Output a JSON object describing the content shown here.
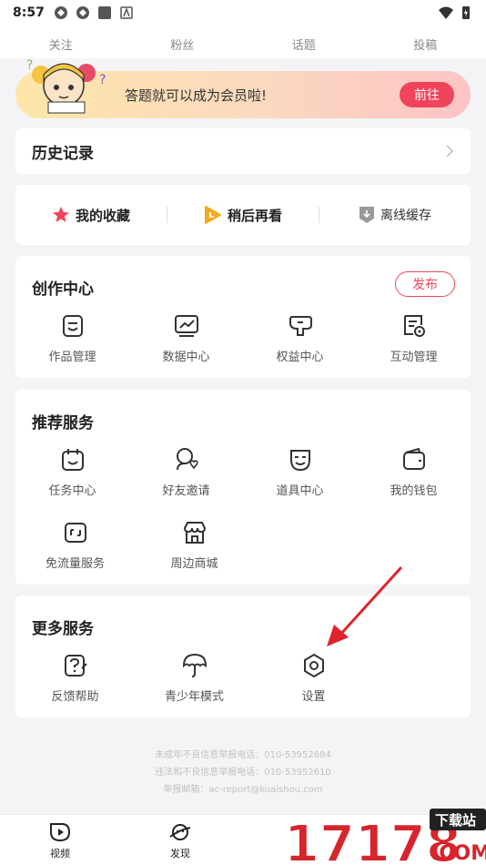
{
  "status_bar": {
    "time": "8:57"
  },
  "stats": [
    {
      "label": "关注"
    },
    {
      "label": "粉丝"
    },
    {
      "label": "话题"
    },
    {
      "label": "投稿"
    }
  ],
  "banner": {
    "text": "答题就可以成为会员啦!",
    "button": "前往"
  },
  "history": {
    "title": "历史记录"
  },
  "quick": {
    "favorites": "我的收藏",
    "watch_later": "稍后再看",
    "offline": "离线缓存"
  },
  "creation": {
    "title": "创作中心",
    "publish": "发布",
    "items": [
      {
        "label": "作品管理"
      },
      {
        "label": "数据中心"
      },
      {
        "label": "权益中心"
      },
      {
        "label": "互动管理"
      }
    ]
  },
  "recommended": {
    "title": "推荐服务",
    "items": [
      {
        "label": "任务中心"
      },
      {
        "label": "好友邀请"
      },
      {
        "label": "道具中心"
      },
      {
        "label": "我的钱包"
      },
      {
        "label": "免流量服务"
      },
      {
        "label": "周边商城"
      }
    ]
  },
  "more": {
    "title": "更多服务",
    "items": [
      {
        "label": "反馈帮助"
      },
      {
        "label": "青少年模式"
      },
      {
        "label": "设置"
      }
    ]
  },
  "footer": {
    "line1": "未成年不良信息举报电话：010-53952684",
    "line2": "违法和不良信息举报电话：010-53952610",
    "line3": "举报邮箱：ac-report@kuaishou.com"
  },
  "tabbar": [
    {
      "label": "视频"
    },
    {
      "label": "发现"
    }
  ],
  "watermark": {
    "text": "17178",
    "sub": "下载站",
    "domain": ".COM"
  },
  "colors": {
    "accent": "#f0445a",
    "watch_later": "#f7a91e"
  }
}
